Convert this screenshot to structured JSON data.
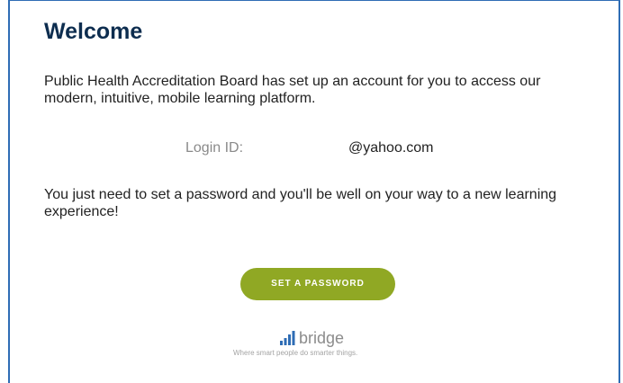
{
  "email": {
    "heading": "Welcome",
    "intro": "Public Health Accreditation Board has set up an account for you to access our modern, intuitive, mobile learning platform.",
    "login_label": "Login ID:",
    "login_value": "@yahoo.com",
    "instruction": "You just need to set a password and you'll be well on your way to a new learning experience!",
    "button_label": "SET A PASSWORD"
  },
  "footer": {
    "brand": "bridge",
    "tagline": "Where smart people do smarter things.",
    "logo_icon": "bar-chart-icon"
  },
  "colors": {
    "border": "#2f6db5",
    "heading": "#0d2d4f",
    "button": "#90a824",
    "brand_bars": "#2f6db5"
  }
}
